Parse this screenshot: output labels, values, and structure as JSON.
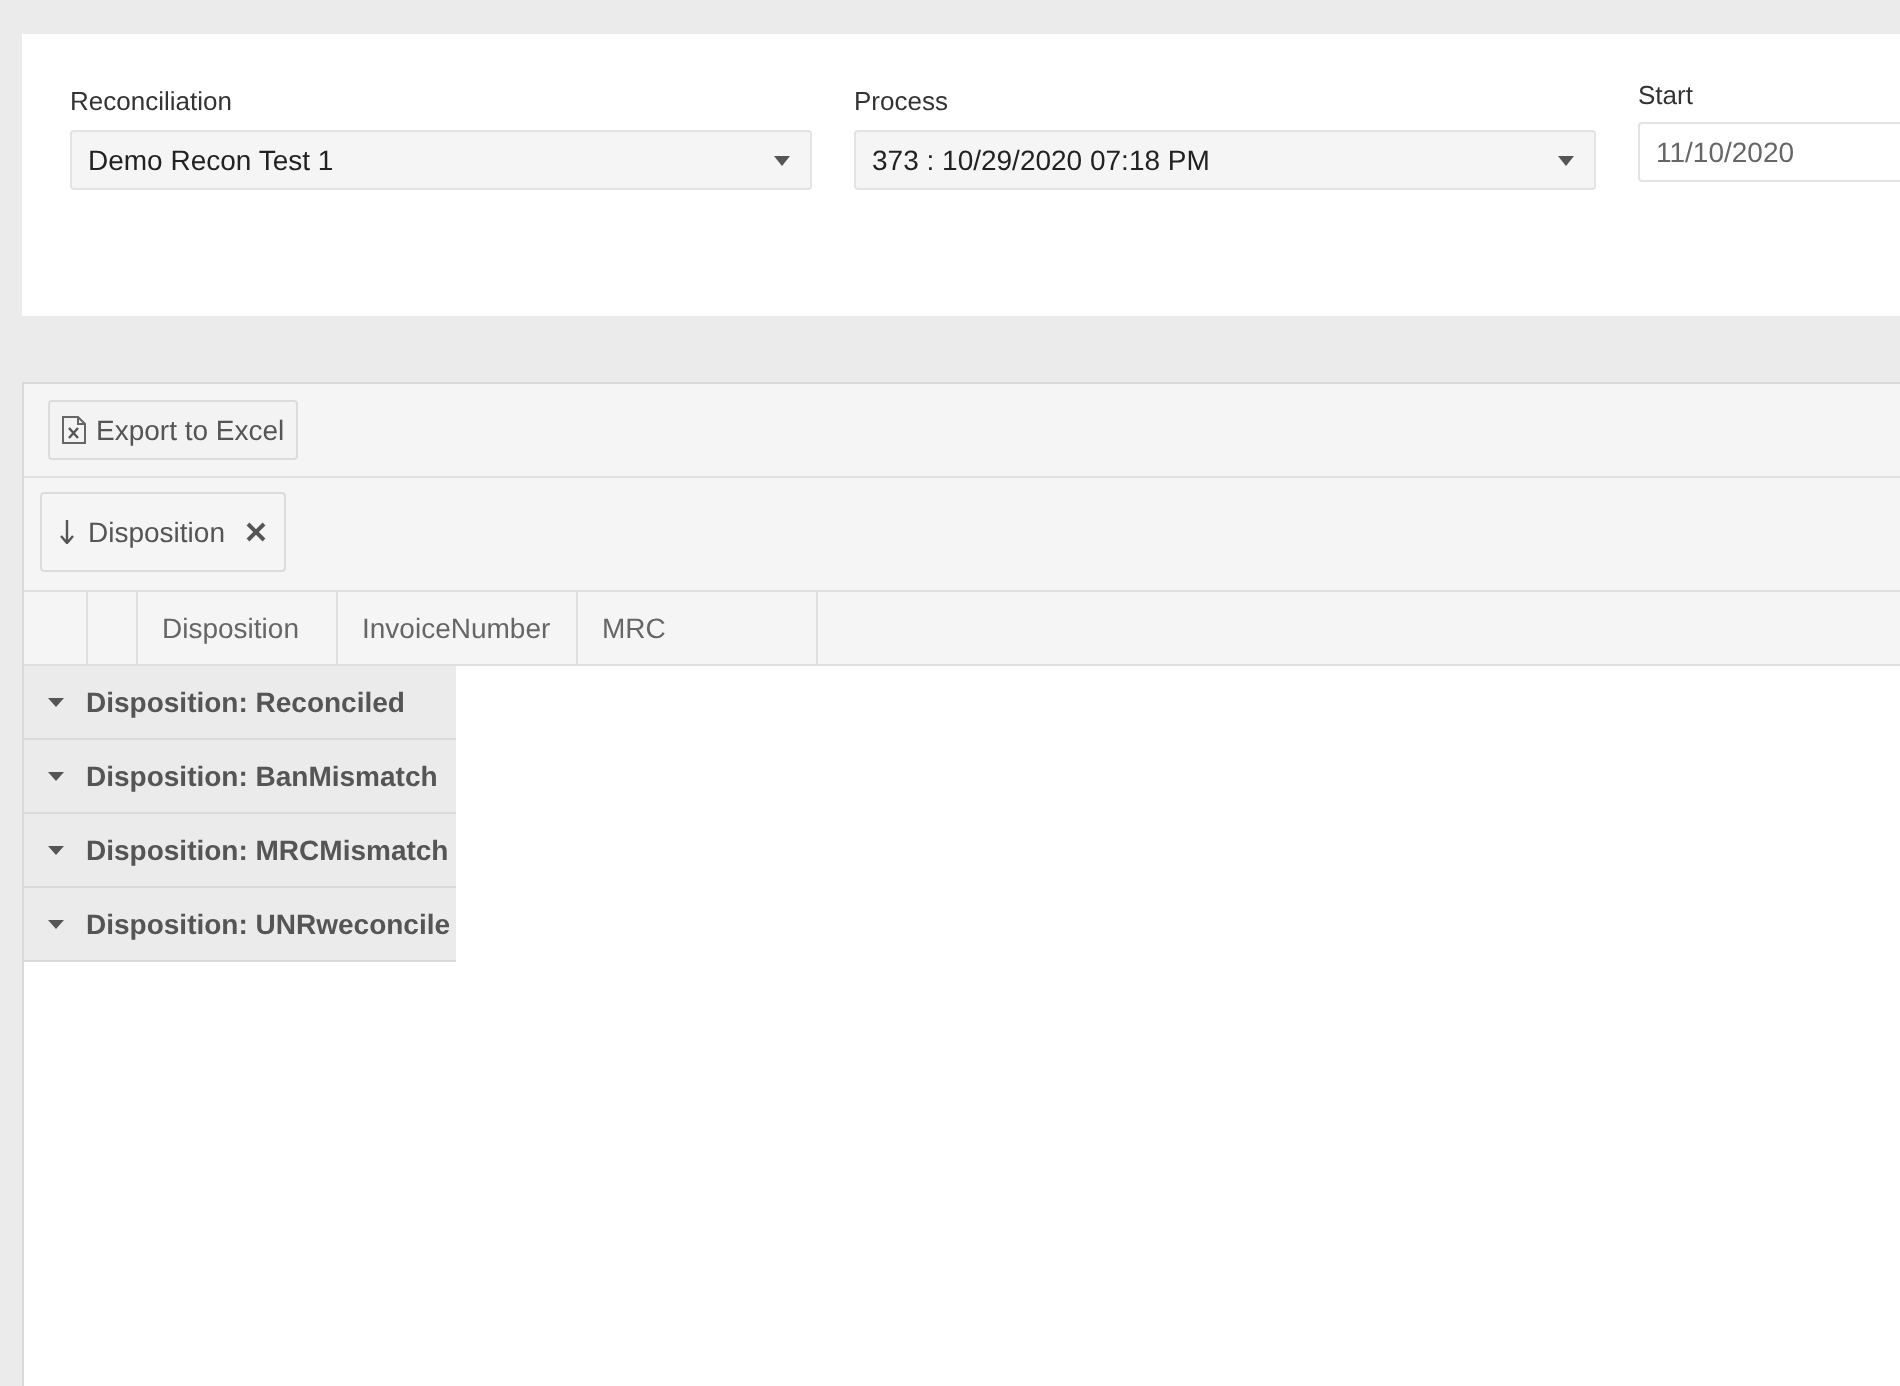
{
  "filters": {
    "reconciliation": {
      "label": "Reconciliation",
      "value": "Demo Recon Test 1"
    },
    "process": {
      "label": "Process",
      "value": "373 : 10/29/2020 07:18 PM"
    },
    "start": {
      "label": "Start",
      "value": "11/10/2020"
    }
  },
  "toolbar": {
    "export_button": "Export to Excel"
  },
  "group_panel": {
    "chips": [
      {
        "label": "Disposition",
        "descending": true
      }
    ]
  },
  "table": {
    "columns": [
      "Disposition",
      "InvoiceNumber",
      "MRC"
    ],
    "groups": [
      {
        "label": "Disposition: Reconciled",
        "expanded": true
      },
      {
        "label": "Disposition: BanMismatch",
        "expanded": true
      },
      {
        "label": "Disposition: MRCMismatch",
        "expanded": true
      },
      {
        "label": "Disposition: UNRweconcile",
        "expanded": true
      }
    ]
  }
}
